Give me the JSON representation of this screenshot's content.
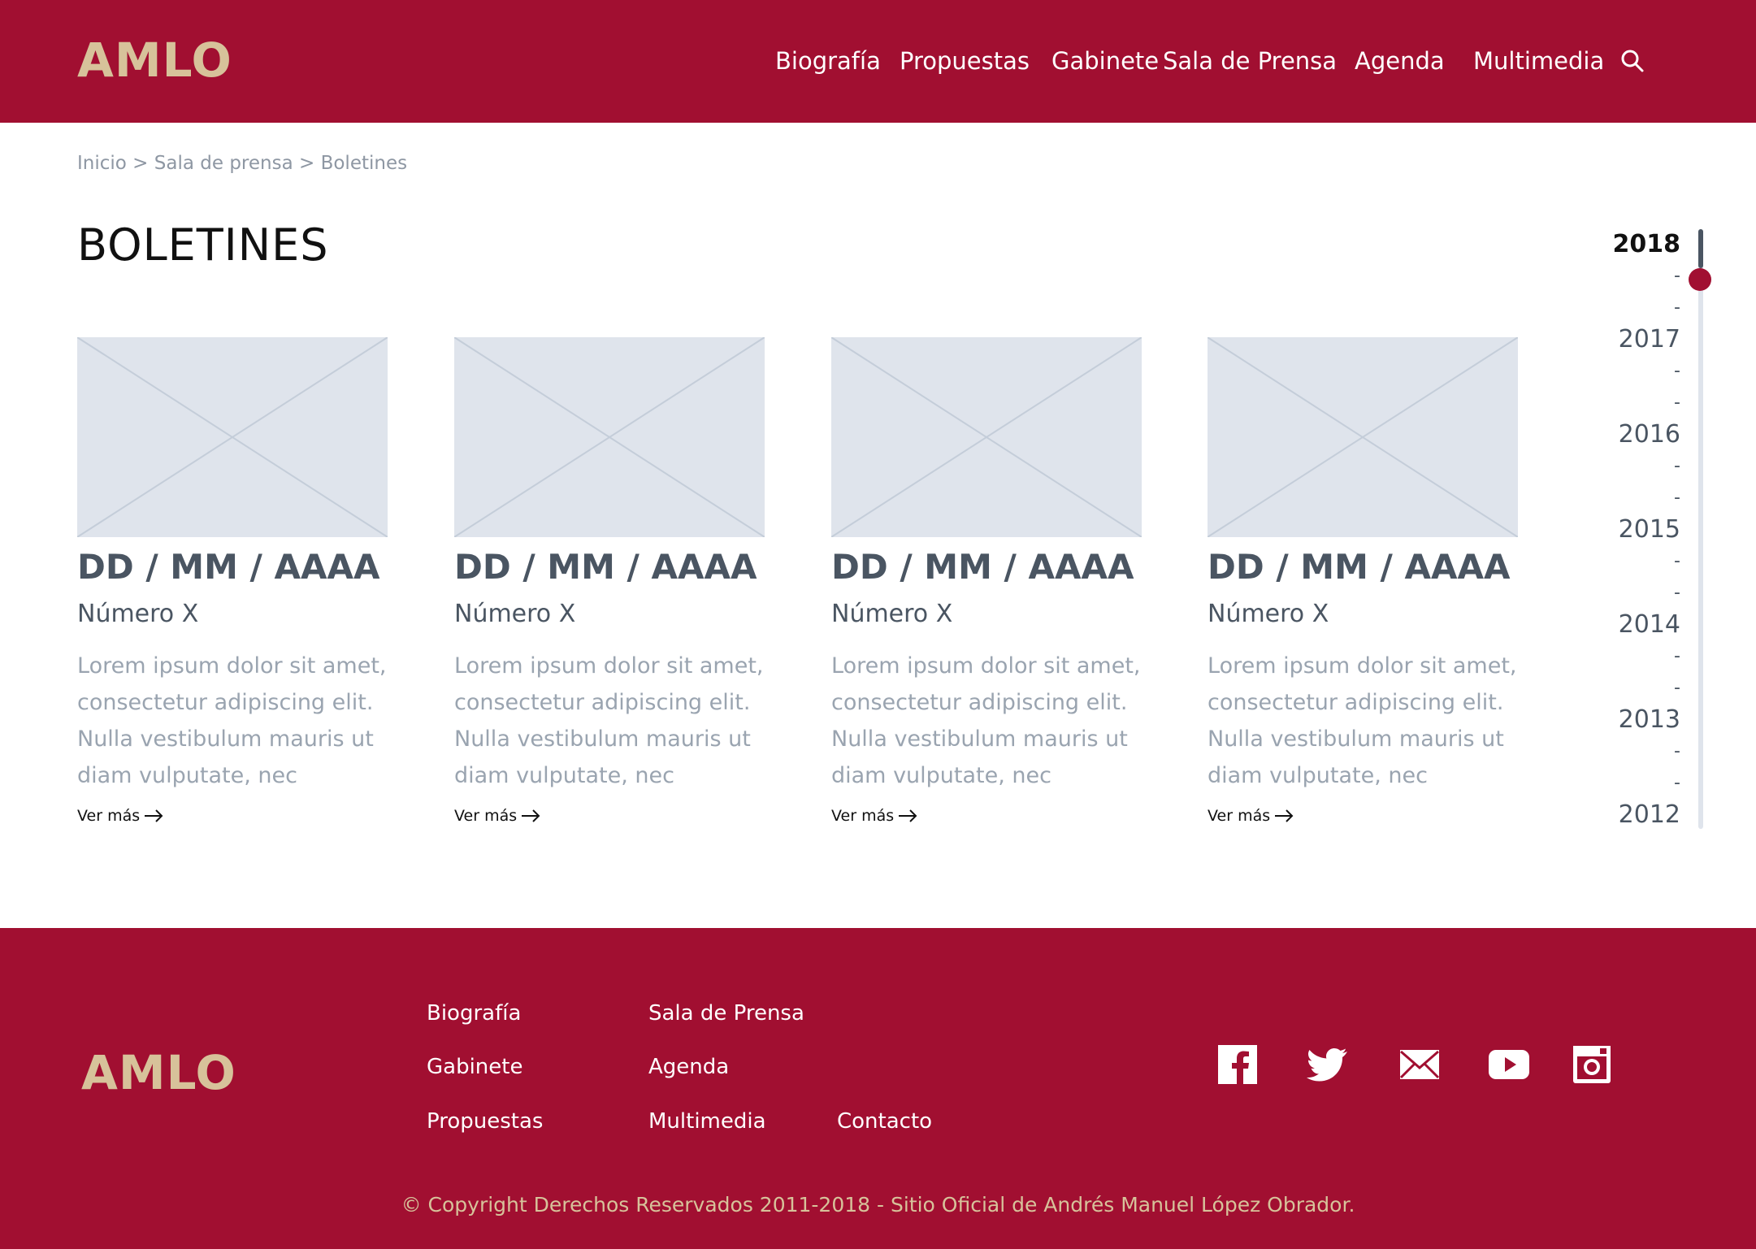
{
  "header": {
    "logo": "AMLO",
    "nav": [
      "Biografía",
      "Propuestas",
      "Gabinete",
      "Sala de Prensa",
      "Agenda",
      "Multimedia"
    ],
    "search_icon": "search-icon"
  },
  "breadcrumb": {
    "items": [
      "Inicio",
      "Sala de prensa",
      "Boletines"
    ],
    "separator": ">"
  },
  "page_title": "BOLETINES",
  "cards": [
    {
      "image": "image-placeholder-icon",
      "date": "DD / MM / AAAA",
      "number": "Número X",
      "desc_lines": [
        "Lorem ipsum dolor sit amet,",
        "consectetur adipiscing elit.",
        "Nulla vestibulum mauris ut",
        "diam vulputate, nec"
      ],
      "more": "Ver más"
    },
    {
      "image": "image-placeholder-icon",
      "date": "DD / MM / AAAA",
      "number": "Número X",
      "desc_lines": [
        "Lorem ipsum dolor sit amet,",
        "consectetur adipiscing elit.",
        "Nulla vestibulum mauris ut",
        "diam vulputate, nec"
      ],
      "more": "Ver más"
    },
    {
      "image": "image-placeholder-icon",
      "date": "DD / MM / AAAA",
      "number": "Número X",
      "desc_lines": [
        "Lorem ipsum dolor sit amet,",
        "consectetur adipiscing elit.",
        "Nulla vestibulum mauris ut",
        "diam vulputate, nec"
      ],
      "more": "Ver más"
    },
    {
      "image": "image-placeholder-icon",
      "date": "DD / MM / AAAA",
      "number": "Número X",
      "desc_lines": [
        "Lorem ipsum dolor sit amet,",
        "consectetur adipiscing elit.",
        "Nulla vestibulum mauris ut",
        "diam vulputate, nec"
      ],
      "more": "Ver más"
    }
  ],
  "timeline": {
    "years": [
      "2018",
      "2017",
      "2016",
      "2015",
      "2014",
      "2013",
      "2012"
    ],
    "selected": "2018",
    "dash": "-"
  },
  "footer": {
    "logo": "AMLO",
    "links": [
      "Biografía",
      "Sala de Prensa",
      "Gabinete",
      "Agenda",
      "Propuestas",
      "Multimedia",
      "Contacto"
    ],
    "social": [
      "facebook-icon",
      "twitter-icon",
      "mail-icon",
      "youtube-icon",
      "instagram-icon"
    ],
    "copyright": "© Copyright Derechos Reservados 2011-2018 - Sitio Oficial de Andrés Manuel López Obrador."
  },
  "colors": {
    "brand": "#a10f31",
    "logo": "#d7c29a",
    "placeholder": "#dfe4ec"
  }
}
